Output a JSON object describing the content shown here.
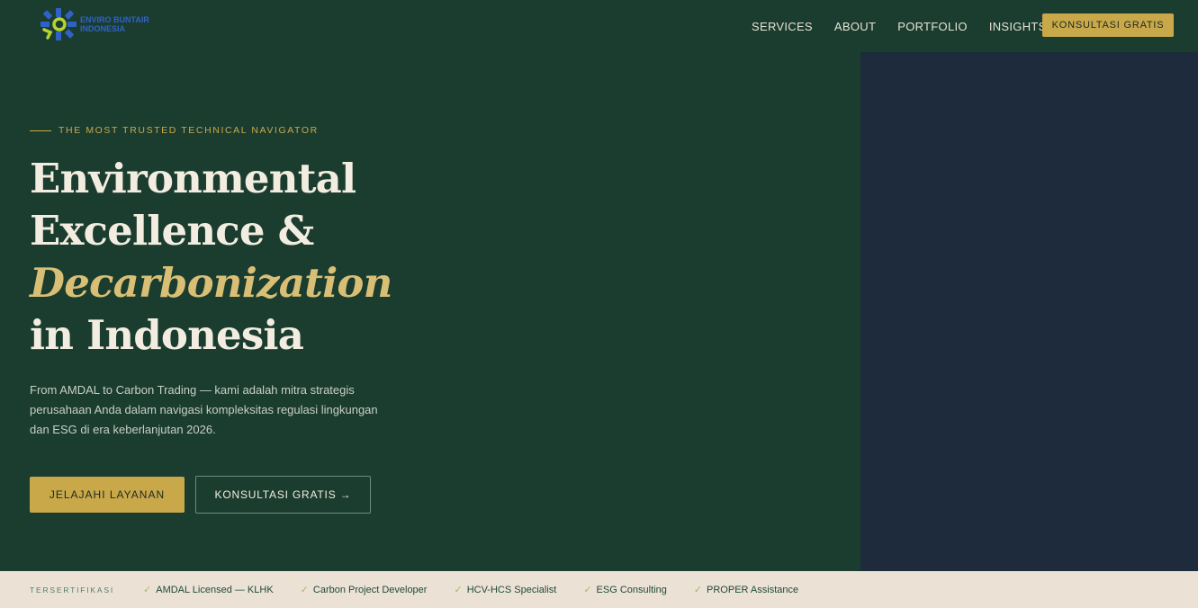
{
  "brand": {
    "name_line1": "ENVIRO BUNTAIR",
    "name_line2": "INDONESIA",
    "colors": {
      "primary_green": "#1b3d2f",
      "gold": "#c9a84a",
      "navy": "#1d2b3c",
      "cream": "#ebe2d5",
      "logo_blue": "#2f62c8",
      "logo_lime": "#b5d334"
    }
  },
  "nav": {
    "items": [
      "SERVICES",
      "ABOUT",
      "PORTFOLIO",
      "INSIGHTS"
    ],
    "cta_label": "KONSULTASI GRATIS"
  },
  "hero": {
    "eyebrow": "THE MOST TRUSTED TECHNICAL NAVIGATOR",
    "headline_line1": "Environmental",
    "headline_line2": "Excellence &",
    "headline_accent": "Decarbonization",
    "headline_line4": "in Indonesia",
    "lead": "From AMDAL to Carbon Trading — kami adalah mitra strategis perusahaan Anda dalam navigasi kompleksitas regulasi lingkungan dan ESG di era keberlanjutan 2026.",
    "primary_button": "JELAJAHI LAYANAN",
    "secondary_button": "KONSULTASI GRATIS →"
  },
  "certifications": {
    "label": "TERSERTIFIKASI",
    "items": [
      "AMDAL Licensed — KLHK",
      "Carbon Project Developer",
      "HCV-HCS Specialist",
      "ESG Consulting",
      "PROPER Assistance"
    ],
    "check_icon": "✓"
  }
}
